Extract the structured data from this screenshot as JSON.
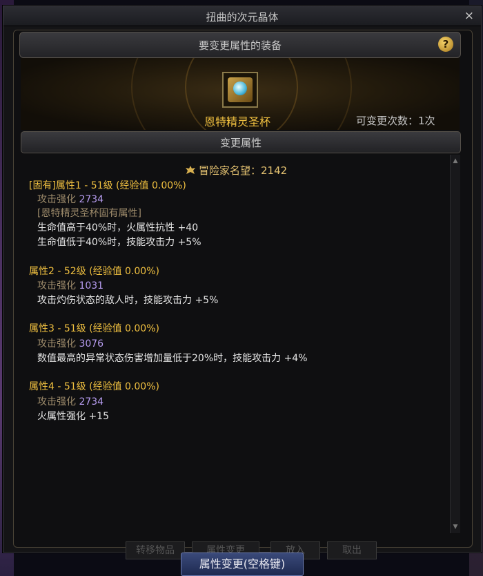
{
  "window": {
    "title": "扭曲的次元晶体",
    "close_glyph": "×"
  },
  "equip": {
    "header": "要变更属性的装备",
    "help_glyph": "?",
    "item_name": "恩特精灵圣杯",
    "change_count": "可变更次数：1次"
  },
  "attributes": {
    "header": "变更属性",
    "fame_label": "冒险家名望：2142",
    "groups": [
      {
        "title": "[固有]属性1 - 51级 (经验值 0.00%)",
        "stat_label": "攻击强化",
        "stat_value": "2734",
        "extra": [
          "[恩特精灵圣杯固有属性]",
          "生命值高于40%时，火属性抗性 +40",
          "生命值低于40%时，技能攻击力 +5%"
        ]
      },
      {
        "title": "属性2 - 52级 (经验值 0.00%)",
        "stat_label": "攻击强化",
        "stat_value": "1031",
        "extra": [
          "攻击灼伤状态的敌人时，技能攻击力 +5%"
        ]
      },
      {
        "title": "属性3 - 51级 (经验值 0.00%)",
        "stat_label": "攻击强化",
        "stat_value": "3076",
        "extra": [
          "数值最高的异常状态伤害增加量低于20%时，技能攻击力 +4%"
        ]
      },
      {
        "title": "属性4 - 51级 (经验值 0.00%)",
        "stat_label": "攻击强化",
        "stat_value": "2734",
        "extra": [
          "火属性强化 +15"
        ]
      }
    ]
  },
  "bottom": {
    "ghost_buttons": [
      "转移物品",
      "属性变更",
      "放入",
      "取出"
    ],
    "main_button": "属性变更(空格键)"
  },
  "colors": {
    "gold": "#f0c040",
    "purple": "#b69cf0",
    "panel_bg": "#0f0f11"
  }
}
